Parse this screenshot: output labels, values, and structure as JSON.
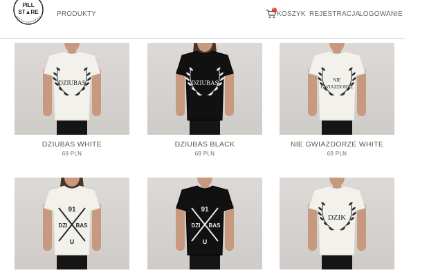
{
  "header": {
    "logo": {
      "line1": "PILL",
      "line2": "ST▲RE"
    },
    "nav": {
      "produkty": "PRODUKTY",
      "koszyk": "KOSZYK",
      "rejestracja": "REJESTRACJA",
      "logowanie": "LOGOWANIE"
    },
    "cart_count": "0",
    "cart_icon": "shopping-cart-icon"
  },
  "products": [
    {
      "name": "DZIUBAS WHITE",
      "price": "69 PLN",
      "print": "DZIUBAS",
      "shirt_color": "#f2f1ec"
    },
    {
      "name": "DZIUBAS BLACK",
      "price": "69 PLN",
      "print": "DZIUBAS",
      "shirt_color": "#111111"
    },
    {
      "name": "NIE GWIAZDORZE WHITE",
      "price": "69 PLN",
      "print": "NIE GWIAZDORZE",
      "shirt_color": "#f2f1ec"
    },
    {
      "name": "",
      "price": "",
      "print": "91 DZI BAS U",
      "shirt_color": "#f2f1ec"
    },
    {
      "name": "",
      "price": "",
      "print": "91 DZI BAS U",
      "shirt_color": "#111111"
    },
    {
      "name": "",
      "price": "",
      "print": "DZIK",
      "shirt_color": "#f2f1ec"
    }
  ]
}
